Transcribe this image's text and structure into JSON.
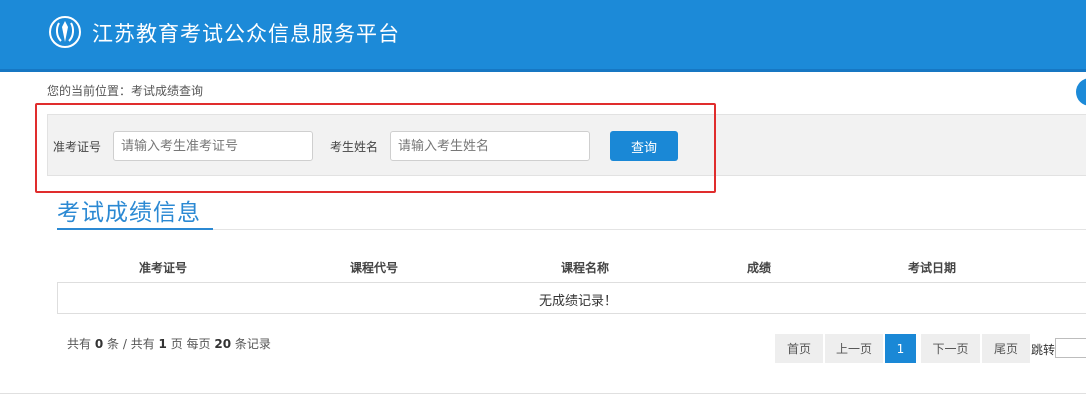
{
  "header": {
    "site_title": "江苏教育考试公众信息服务平台",
    "brand_color": "#1c8ad8",
    "logo_icon": "education-emblem-icon"
  },
  "breadcrumb": "您的当前位置：考试成绩查询",
  "search": {
    "ticket_label": "准考证号",
    "ticket_placeholder": "请输入考生准考证号",
    "ticket_value": "",
    "name_label": "考生姓名",
    "name_placeholder": "请输入考生姓名",
    "name_value": "",
    "submit_label": "查询",
    "highlight_color": "#e02d2d"
  },
  "results": {
    "section_title": "考试成绩信息",
    "columns": [
      "准考证号",
      "课程代号",
      "课程名称",
      "成绩",
      "考试日期"
    ],
    "empty_message": "无成绩记录！"
  },
  "summary": {
    "prefix": "共有",
    "record_count": "0",
    "record_unit": "条 / 共有",
    "page_count": "1",
    "page_unit": "页 每页",
    "per_page": "20",
    "per_page_unit": "条记录"
  },
  "pagination": {
    "first": "首页",
    "prev": "上一页",
    "current": "1",
    "next": "下一页",
    "last": "尾页",
    "jump_label": "跳转"
  }
}
